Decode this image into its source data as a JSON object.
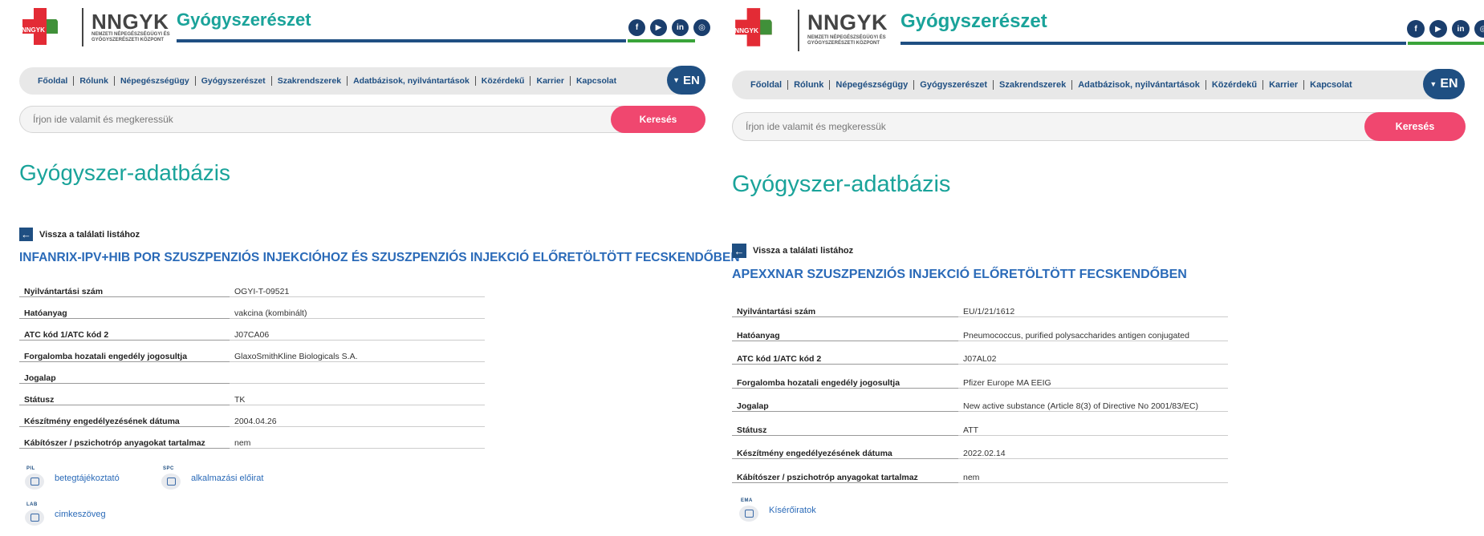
{
  "brand": {
    "name": "NNGYK",
    "subtitle": "Nemzeti Népegészségügyi és Gyógyszerészeti Központ",
    "logo_badge": "NNGYK",
    "section": "Gyógyszerészet"
  },
  "social": [
    "facebook-icon",
    "youtube-icon",
    "linkedin-icon",
    "instagram-icon"
  ],
  "nav": {
    "items": [
      "Főoldal",
      "Rólunk",
      "Népegészségügy",
      "Gyógyszerészet",
      "Szakrendszerek",
      "Adatbázisok, nyilvántartások",
      "Közérdekű",
      "Karrier",
      "Kapcsolat"
    ],
    "lang": "EN"
  },
  "search": {
    "placeholder": "Írjon ide valamit és megkeressük",
    "button": "Keresés"
  },
  "page_title": "Gyógyszer-adatbázis",
  "back_label": "Vissza a találati listához",
  "left": {
    "drug_title": "INFANRIX-IPV+HIB POR SZUSZPENZIÓS INJEKCIÓHOZ ÉS SZUSZPENZIÓS INJEKCIÓ ELŐRETÖLTÖTT FECSKENDŐBEN",
    "rows": [
      {
        "label": "Nyilvántartási szám",
        "value": "OGYI-T-09521"
      },
      {
        "label": "Hatóanyag",
        "value": "vakcina (kombinált)"
      },
      {
        "label": "ATC kód 1/ATC kód 2",
        "value": "J07CA06"
      },
      {
        "label": "Forgalomba hozatali engedély jogosultja",
        "value": "GlaxoSmithKline Biologicals S.A."
      },
      {
        "label": "Jogalap",
        "value": ""
      },
      {
        "label": "Státusz",
        "value": "TK"
      },
      {
        "label": "Készítmény engedélyezésének dátuma",
        "value": "2004.04.26"
      },
      {
        "label": "Kábítószer / pszichotróp anyagokat tartalmaz",
        "value": "nem"
      }
    ],
    "docs": [
      {
        "tag": "PIL",
        "label": "betegtájékoztató"
      },
      {
        "tag": "SPC",
        "label": "alkalmazási előirat"
      },
      {
        "tag": "LAB",
        "label": "cimkeszöveg"
      }
    ]
  },
  "right": {
    "drug_title": "APEXXNAR SZUSZPENZIÓS INJEKCIÓ ELŐRETÖLTÖTT FECSKENDŐBEN",
    "rows": [
      {
        "label": "Nyilvántartási szám",
        "value": "EU/1/21/1612"
      },
      {
        "label": "Hatóanyag",
        "value": "Pneumococcus, purified polysaccharides antigen conjugated"
      },
      {
        "label": "ATC kód 1/ATC kód 2",
        "value": "J07AL02"
      },
      {
        "label": "Forgalomba hozatali engedély jogosultja",
        "value": "Pfizer Europe MA EEIG"
      },
      {
        "label": "Jogalap",
        "value": "New active substance (Article 8(3) of Directive No 2001/83/EC)"
      },
      {
        "label": "Státusz",
        "value": "ATT"
      },
      {
        "label": "Készítmény engedélyezésének dátuma",
        "value": "2022.02.14"
      },
      {
        "label": "Kábítószer / pszichotróp anyagokat tartalmaz",
        "value": "nem"
      }
    ],
    "docs": [
      {
        "tag": "EMA",
        "label": "Kísérőiratok"
      }
    ]
  },
  "colors": {
    "teal": "#1aa39a",
    "navy": "#1f4f82",
    "pink": "#f0476f",
    "green": "#3aa43a",
    "link": "#2a6ab8"
  }
}
